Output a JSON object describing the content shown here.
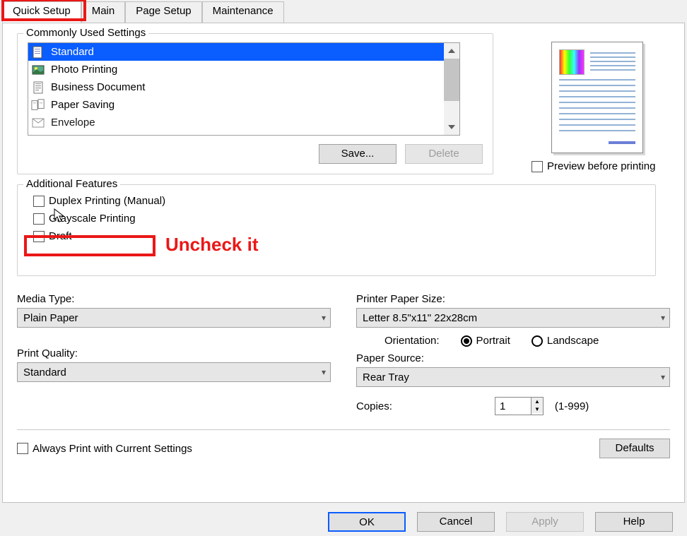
{
  "tabs": {
    "quick_setup": "Quick Setup",
    "main": "Main",
    "page_setup": "Page Setup",
    "maintenance": "Maintenance"
  },
  "commonly_used": {
    "legend": "Commonly Used Settings",
    "items": [
      {
        "label": "Standard"
      },
      {
        "label": "Photo Printing"
      },
      {
        "label": "Business Document"
      },
      {
        "label": "Paper Saving"
      },
      {
        "label": "Envelope"
      }
    ],
    "save_btn": "Save...",
    "delete_btn": "Delete"
  },
  "preview_checkbox": "Preview before printing",
  "additional": {
    "legend": "Additional Features",
    "duplex": "Duplex Printing (Manual)",
    "grayscale": "Grayscale Printing",
    "draft": "Draft"
  },
  "annotation": "Uncheck it",
  "media_type": {
    "label": "Media Type:",
    "value": "Plain Paper"
  },
  "print_quality": {
    "label": "Print Quality:",
    "value": "Standard"
  },
  "paper_size": {
    "label": "Printer Paper Size:",
    "value": "Letter 8.5\"x11\" 22x28cm"
  },
  "orientation": {
    "label": "Orientation:",
    "portrait": "Portrait",
    "landscape": "Landscape"
  },
  "paper_source": {
    "label": "Paper Source:",
    "value": "Rear Tray"
  },
  "copies": {
    "label": "Copies:",
    "value": "1",
    "range": "(1-999)"
  },
  "always_print": "Always Print with Current Settings",
  "defaults_btn": "Defaults",
  "buttons": {
    "ok": "OK",
    "cancel": "Cancel",
    "apply": "Apply",
    "help": "Help"
  }
}
